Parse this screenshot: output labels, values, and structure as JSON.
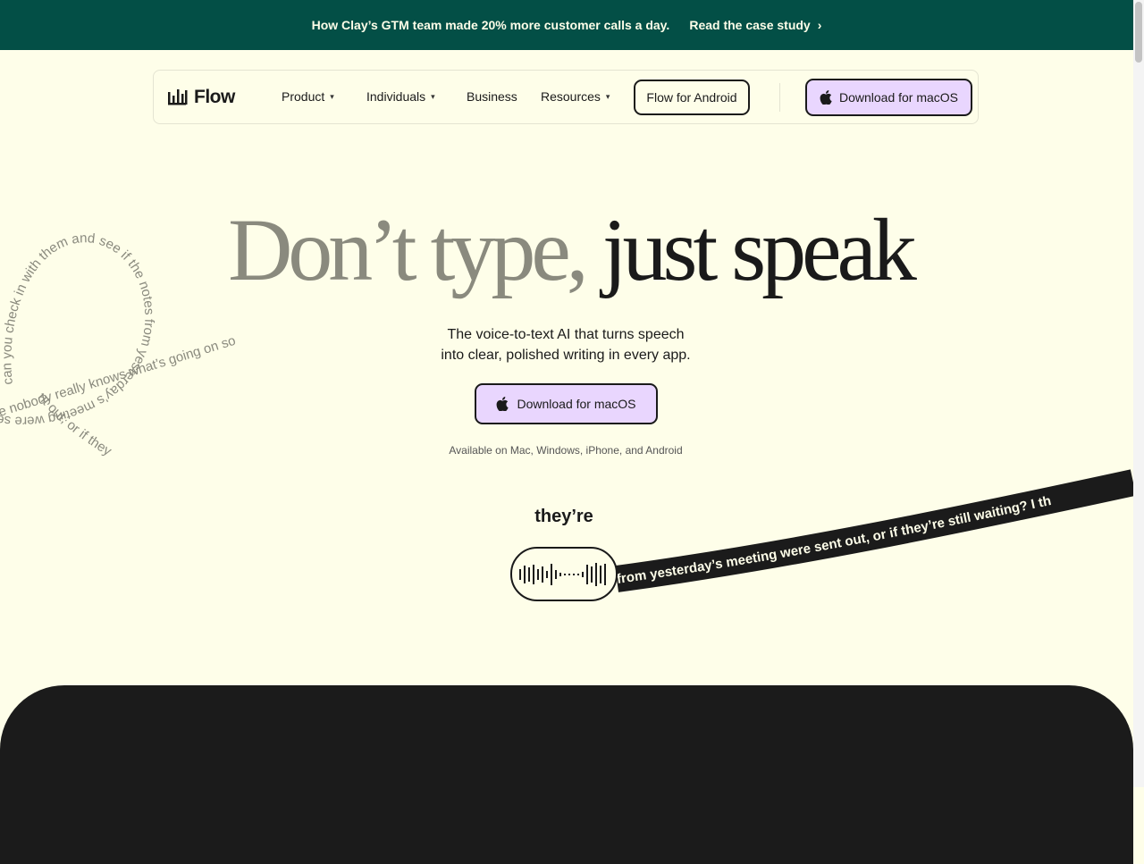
{
  "banner": {
    "text": "How Clay’s GTM team made 20% more customer calls a day.",
    "cta": "Read the case study",
    "cta_arrow": "›"
  },
  "colors": {
    "banner_bg": "#034f46",
    "page_bg": "#fefee9",
    "accent_purple": "#e9d6fe",
    "ink": "#1a1a1a",
    "muted_ink": "#8a8a7e"
  },
  "nav": {
    "logo": "Flow",
    "logo_icon": "sound-bars-icon",
    "items": [
      {
        "label": "Product",
        "dropdown": true
      },
      {
        "label": "Individuals",
        "dropdown": true
      },
      {
        "label": "Business",
        "dropdown": false
      },
      {
        "label": "Resources",
        "dropdown": true
      }
    ],
    "chevron": "⌄",
    "android_button": "Flow for Android",
    "mac_button": "Download for macOS",
    "mac_icon": "apple-icon"
  },
  "hero": {
    "title_muted": "Don’t type,",
    "title_strong": "just speak",
    "subtitle_line1": "The voice-to-text AI that turns speech",
    "subtitle_line2": "into clear, polished writing in every app.",
    "button": "Download for macOS",
    "availability": "Available on Mac, Windows, iPhone, and Android"
  },
  "transcript": {
    "current_word": "they’re",
    "spoken_text": "can you check in with them and see if the notes from yesterday’s meeting were sent out, or if they",
    "loop_fragment": "e nobody really knows what’s going on so",
    "written_text": "from yesterday’s meeting were sent out, or if they’re still waiting? I th",
    "mic_icon": "waveform-icon"
  }
}
